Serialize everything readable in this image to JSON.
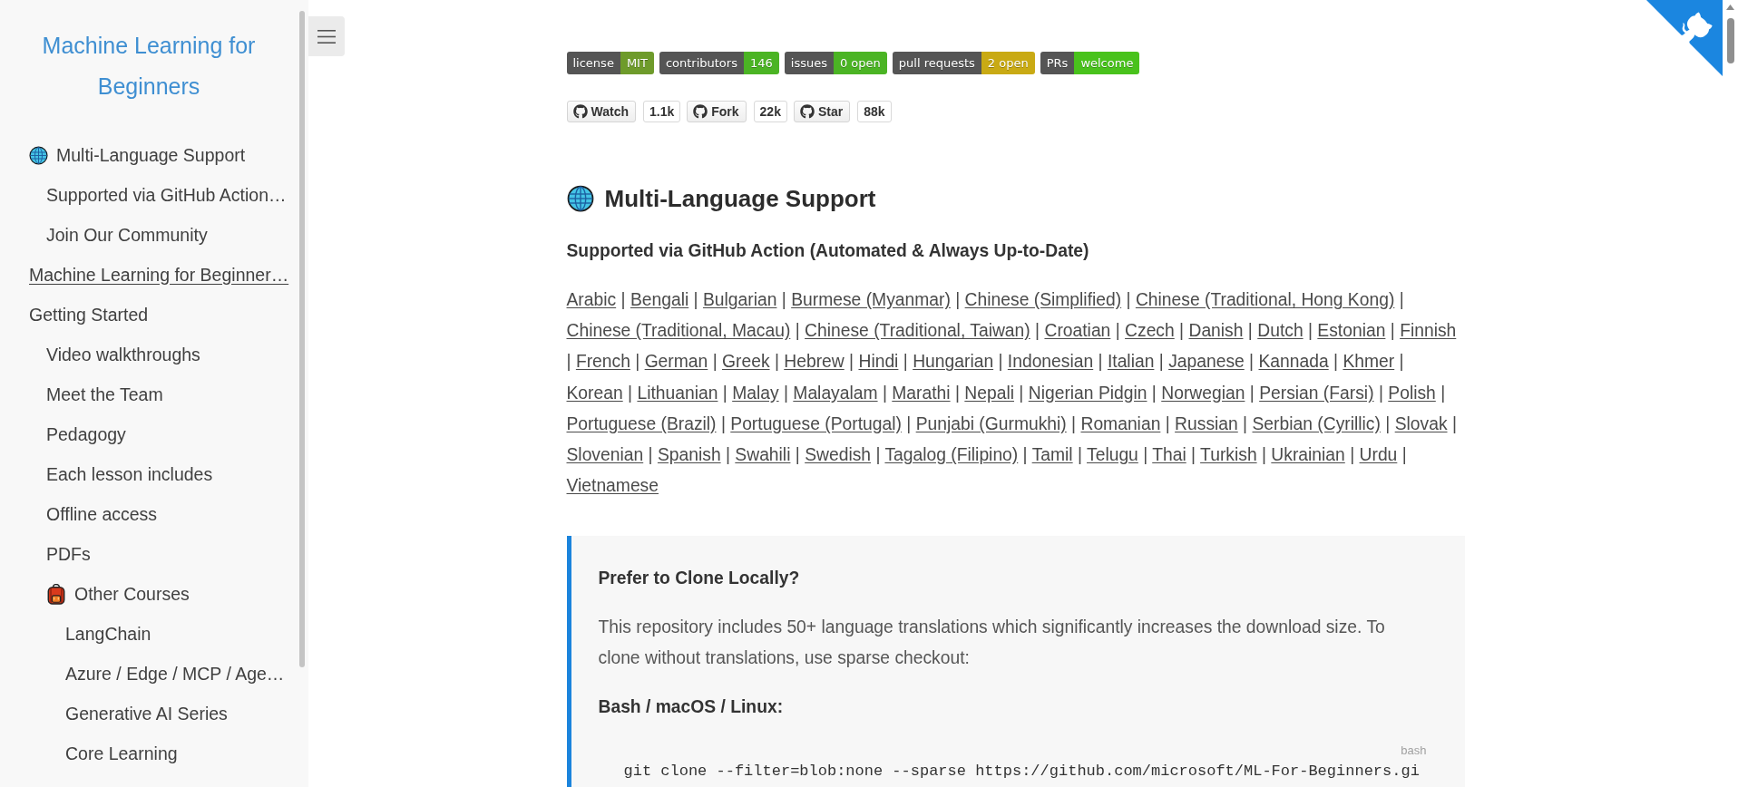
{
  "sidebar": {
    "title": "Machine Learning for Beginners",
    "items": [
      {
        "label": "Multi-Language Support",
        "kind": "globe",
        "selected": false,
        "children": [
          {
            "label": "Supported via GitHub Action…",
            "selected": false
          },
          {
            "label": "Join Our Community",
            "selected": false
          }
        ]
      },
      {
        "label": "Machine Learning for Beginner…",
        "selected": true
      },
      {
        "label": "Getting Started",
        "selected": false,
        "children": [
          {
            "label": "Video walkthroughs",
            "selected": false
          },
          {
            "label": "Meet the Team",
            "selected": false
          },
          {
            "label": "Pedagogy",
            "selected": false
          },
          {
            "label": "Each lesson includes",
            "selected": false
          },
          {
            "label": "Offline access",
            "selected": false
          },
          {
            "label": "PDFs",
            "selected": false
          },
          {
            "label": "Other Courses",
            "kind": "backpack",
            "selected": false,
            "children": [
              {
                "label": "LangChain",
                "selected": false
              },
              {
                "label": "Azure / Edge / MCP / Age…",
                "selected": false
              },
              {
                "label": "Generative AI Series",
                "selected": false
              },
              {
                "label": "Core Learning",
                "selected": false
              }
            ]
          }
        ]
      }
    ]
  },
  "badges": [
    {
      "label": "license",
      "value": "MIT",
      "color": "#6e9b2b"
    },
    {
      "label": "contributors",
      "value": "146",
      "color": "#4bb424"
    },
    {
      "label": "issues",
      "value": "0 open",
      "color": "#4bb424"
    },
    {
      "label": "pull requests",
      "value": "2 open",
      "color": "#c9aa14"
    },
    {
      "label": "PRs",
      "value": "welcome",
      "color": "#49c21c"
    }
  ],
  "github_buttons": [
    {
      "label": "Watch",
      "count": "1.1k"
    },
    {
      "label": "Fork",
      "count": "22k"
    },
    {
      "label": "Star",
      "count": "88k"
    }
  ],
  "section": {
    "heading": "Multi-Language Support",
    "subheading": "Supported via GitHub Action (Automated & Always Up-to-Date)",
    "separator": "|",
    "languages": [
      "Arabic",
      "Bengali",
      "Bulgarian",
      "Burmese (Myanmar)",
      "Chinese (Simplified)",
      "Chinese (Traditional, Hong Kong)",
      "Chinese (Traditional, Macau)",
      "Chinese (Traditional, Taiwan)",
      "Croatian",
      "Czech",
      "Danish",
      "Dutch",
      "Estonian",
      "Finnish",
      "French",
      "German",
      "Greek",
      "Hebrew",
      "Hindi",
      "Hungarian",
      "Indonesian",
      "Italian",
      "Japanese",
      "Kannada",
      "Khmer",
      "Korean",
      "Lithuanian",
      "Malay",
      "Malayalam",
      "Marathi",
      "Nepali",
      "Nigerian Pidgin",
      "Norwegian",
      "Persian (Farsi)",
      "Polish",
      "Portuguese (Brazil)",
      "Portuguese (Portugal)",
      "Punjabi (Gurmukhi)",
      "Romanian",
      "Russian",
      "Serbian (Cyrillic)",
      "Slovak",
      "Slovenian",
      "Spanish",
      "Swahili",
      "Swedish",
      "Tagalog (Filipino)",
      "Tamil",
      "Telugu",
      "Thai",
      "Turkish",
      "Ukrainian",
      "Urdu",
      "Vietnamese"
    ]
  },
  "callout": {
    "title": "Prefer to Clone Locally?",
    "text": "This repository includes 50+ language translations which significantly increases the download size. To clone without translations, use sparse checkout:",
    "subtitle": "Bash / macOS / Linux:",
    "code_language": "bash",
    "code": "git clone --filter=blob:none --sparse https://github.com/microsoft/ML-For-Beginners.gi"
  }
}
